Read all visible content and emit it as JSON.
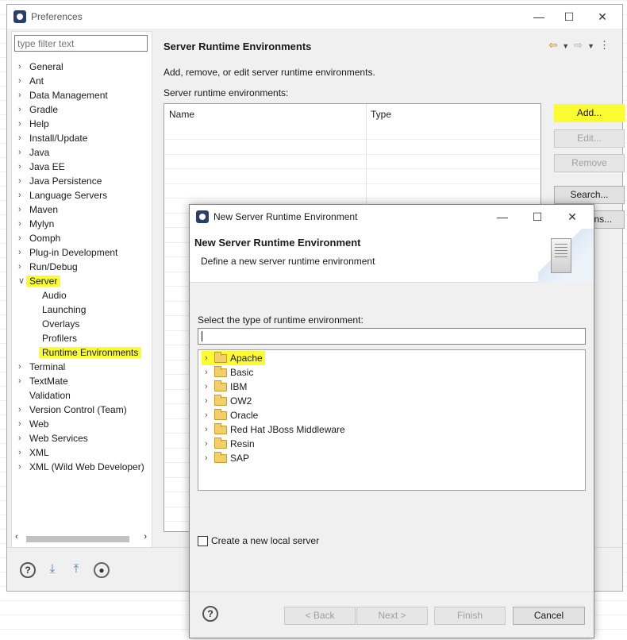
{
  "prefs": {
    "title": "Preferences",
    "filter_placeholder": "type filter text",
    "tree": [
      {
        "label": "General",
        "expanded": false
      },
      {
        "label": "Ant",
        "expanded": false
      },
      {
        "label": "Data Management",
        "expanded": false
      },
      {
        "label": "Gradle",
        "expanded": false
      },
      {
        "label": "Help",
        "expanded": false
      },
      {
        "label": "Install/Update",
        "expanded": false
      },
      {
        "label": "Java",
        "expanded": false
      },
      {
        "label": "Java EE",
        "expanded": false
      },
      {
        "label": "Java Persistence",
        "expanded": false
      },
      {
        "label": "Language Servers",
        "expanded": false
      },
      {
        "label": "Maven",
        "expanded": false
      },
      {
        "label": "Mylyn",
        "expanded": false
      },
      {
        "label": "Oomph",
        "expanded": false
      },
      {
        "label": "Plug-in Development",
        "expanded": false
      },
      {
        "label": "Run/Debug",
        "expanded": false
      },
      {
        "label": "Server",
        "expanded": true
      },
      {
        "label": "Audio"
      },
      {
        "label": "Launching"
      },
      {
        "label": "Overlays"
      },
      {
        "label": "Profilers"
      },
      {
        "label": "Runtime Environments"
      },
      {
        "label": "Terminal",
        "expanded": false
      },
      {
        "label": "TextMate",
        "expanded": false
      },
      {
        "label": "Validation"
      },
      {
        "label": "Version Control (Team)",
        "expanded": false
      },
      {
        "label": "Web",
        "expanded": false
      },
      {
        "label": "Web Services",
        "expanded": false
      },
      {
        "label": "XML",
        "expanded": false
      },
      {
        "label": "XML (Wild Web Developer)",
        "expanded": false
      }
    ],
    "panel_title": "Server Runtime Environments",
    "panel_desc": "Add, remove, or edit server runtime environments.",
    "env_label": "Server runtime environments:",
    "table_headers": [
      "Name",
      "Type"
    ],
    "buttons": {
      "add": "Add...",
      "edit": "Edit...",
      "remove": "Remove",
      "search": "Search...",
      "columns": "Columns..."
    }
  },
  "dialog": {
    "title": "New Server Runtime Environment",
    "header_title": "New Server Runtime Environment",
    "header_subtitle": "Define a new server runtime environment",
    "select_label": "Select the type of runtime environment:",
    "types": [
      "Apache",
      "Basic",
      "IBM",
      "OW2",
      "Oracle",
      "Red Hat JBoss Middleware",
      "Resin",
      "SAP"
    ],
    "checkbox_label": "Create a new local server",
    "buttons": {
      "back": "< Back",
      "next": "Next >",
      "finish": "Finish",
      "cancel": "Cancel"
    }
  },
  "colors": {
    "highlight": "#fbfb32",
    "folder": "#f3cf6a"
  }
}
